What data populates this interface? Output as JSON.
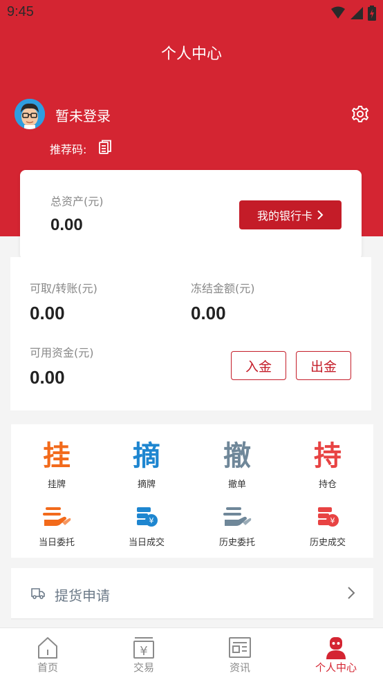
{
  "status_bar": {
    "time": "9:45"
  },
  "header": {
    "title": "个人中心"
  },
  "user": {
    "login_text": "暂未登录",
    "referral_label": "推荐码:"
  },
  "assets": {
    "total_label": "总资产(元)",
    "total_value": "0.00",
    "bank_button": "我的银行卡"
  },
  "funds": {
    "withdrawable_label": "可取/转账(元)",
    "withdrawable_value": "0.00",
    "frozen_label": "冻结金额(元)",
    "frozen_value": "0.00",
    "available_label": "可用资金(元)",
    "available_value": "0.00",
    "deposit_button": "入金",
    "withdraw_button": "出金"
  },
  "menu": {
    "row1": [
      {
        "glyph": "挂",
        "label": "挂牌",
        "color": "#f26a1b"
      },
      {
        "glyph": "摘",
        "label": "摘牌",
        "color": "#1e86d0"
      },
      {
        "glyph": "撤",
        "label": "撤单",
        "color": "#6f8799"
      },
      {
        "glyph": "持",
        "label": "持仓",
        "color": "#e84343"
      }
    ],
    "row2": [
      {
        "icon": "hand-money-icon",
        "label": "当日委托",
        "color": "#f26a1b"
      },
      {
        "icon": "coins-icon",
        "label": "当日成交",
        "color": "#1e86d0"
      },
      {
        "icon": "hand-money-icon",
        "label": "历史委托",
        "color": "#6f8799"
      },
      {
        "icon": "coins-icon",
        "label": "历史成交",
        "color": "#e84343"
      }
    ]
  },
  "apply": {
    "label": "提货申请"
  },
  "tabbar": {
    "tabs": [
      {
        "label": "首页",
        "icon": "home-icon"
      },
      {
        "label": "交易",
        "icon": "trade-icon"
      },
      {
        "label": "资讯",
        "icon": "news-icon"
      },
      {
        "label": "个人中心",
        "icon": "profile-icon"
      }
    ],
    "active_color": "#d42532"
  },
  "colors": {
    "brand": "#d42532",
    "button": "#c41c28"
  }
}
